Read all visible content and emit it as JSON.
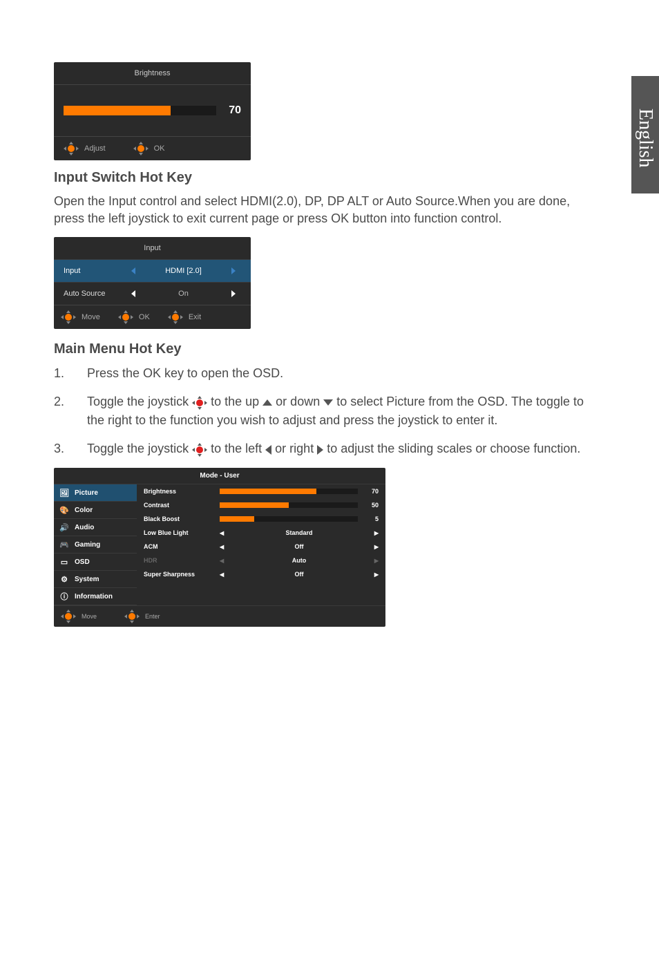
{
  "language_tab": "English",
  "brightness_panel": {
    "title": "Brightness",
    "value": "70",
    "fill_percent": 70,
    "hint_adjust": "Adjust",
    "hint_ok": "OK"
  },
  "sections": {
    "input_switch": {
      "heading": "Input Switch Hot Key",
      "paragraph": "Open the Input control and select HDMI(2.0),  DP, DP ALT or Auto Source.When you are done, press the left joystick to exit current page or press OK button into function control."
    },
    "main_menu": {
      "heading": "Main Menu Hot Key",
      "step1": "Press the OK key to open the OSD.",
      "step2_a": "Toggle the joystick ",
      "step2_b": " to the up ",
      "step2_c": " or down ",
      "step2_d": " to select Picture from the OSD. The toggle to the right to the function you wish to adjust and press the joystick to enter it.",
      "step3_a": "Toggle the joystick ",
      "step3_b": " to the left ",
      "step3_c": " or right ",
      "step3_d": " to adjust the sliding scales or choose function."
    }
  },
  "input_panel": {
    "title": "Input",
    "rows": [
      {
        "label": "Input",
        "value": "HDMI [2.0]",
        "selected": true
      },
      {
        "label": "Auto Source",
        "value": "On",
        "selected": false
      }
    ],
    "hint_move": "Move",
    "hint_ok": "OK",
    "hint_exit": "Exit"
  },
  "main_panel": {
    "title": "Mode - User",
    "sidebar": [
      {
        "label": "Picture",
        "selected": true,
        "icon": "🖼"
      },
      {
        "label": "Color",
        "selected": false,
        "icon": "🎨"
      },
      {
        "label": "Audio",
        "selected": false,
        "icon": "🔊"
      },
      {
        "label": "Gaming",
        "selected": false,
        "icon": "🎮"
      },
      {
        "label": "OSD",
        "selected": false,
        "icon": "▭"
      },
      {
        "label": "System",
        "selected": false,
        "icon": "⚙"
      },
      {
        "label": "Information",
        "selected": false,
        "icon": "ⓘ"
      }
    ],
    "rows": [
      {
        "type": "slider",
        "label": "Brightness",
        "value": "70",
        "fill": 70
      },
      {
        "type": "slider",
        "label": "Contrast",
        "value": "50",
        "fill": 50
      },
      {
        "type": "slider",
        "label": "Black Boost",
        "value": "5",
        "fill": 25
      },
      {
        "type": "select",
        "label": "Low Blue Light",
        "value": "Standard",
        "disabled": false
      },
      {
        "type": "select",
        "label": "ACM",
        "value": "Off",
        "disabled": false
      },
      {
        "type": "select",
        "label": "HDR",
        "value": "Auto",
        "disabled": true
      },
      {
        "type": "select",
        "label": "Super Sharpness",
        "value": "Off",
        "disabled": false
      }
    ],
    "hint_move": "Move",
    "hint_enter": "Enter"
  }
}
